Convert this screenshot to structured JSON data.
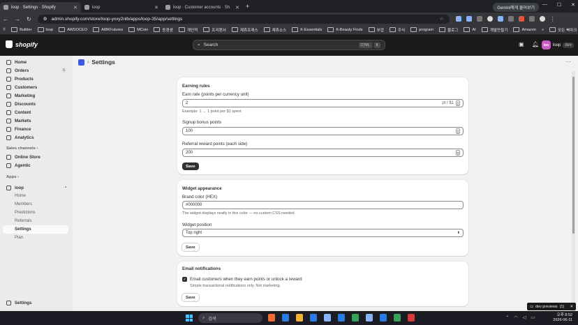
{
  "browser": {
    "tabs": [
      {
        "label": "loop · Settings · Shopify",
        "active": true
      },
      {
        "label": "loop",
        "active": false
      },
      {
        "label": "loop · Customer accounts · Sh",
        "active": false
      }
    ],
    "url": "admin.shopify.com/store/loop-yxxy2nlb/apps/loop-35/app/settings",
    "gemini": "Gemini에게 물어보기",
    "bookmarks": [
      "Builder",
      "loop",
      "AWSOCEO",
      "AI8KFutures",
      "MCoin",
      "동경생",
      "개인적",
      "프리랜서",
      "제휴프레스",
      "제휴소스",
      "K-Essentials",
      "K-Beauty Finds",
      "부업",
      "주식",
      "program",
      "블로그",
      "AI",
      "개발만들기",
      "Amazon",
      "모든 북마크"
    ]
  },
  "shopify": {
    "brand": "shopify",
    "search_placeholder": "Search",
    "shortcut": [
      "CTRL",
      "K"
    ],
    "store_initials": "loo",
    "store_name": "loop",
    "store_tag": "dev"
  },
  "sidebar": {
    "items": [
      {
        "label": "Home"
      },
      {
        "label": "Orders",
        "count": "5"
      },
      {
        "label": "Products"
      },
      {
        "label": "Customers"
      },
      {
        "label": "Marketing"
      },
      {
        "label": "Discounts"
      },
      {
        "label": "Content"
      },
      {
        "label": "Markets"
      },
      {
        "label": "Finance"
      },
      {
        "label": "Analytics"
      }
    ],
    "sales_channels": "Sales channels",
    "channels": [
      {
        "label": "Online Store"
      },
      {
        "label": "Agentic"
      }
    ],
    "apps": "Apps",
    "app_name": "loop",
    "app_sub": [
      "Home",
      "Members",
      "Predictions",
      "Referrals",
      "Settings",
      "Plan"
    ],
    "settings": "Settings"
  },
  "page": {
    "title": "Settings"
  },
  "earn": {
    "title": "Earning rules",
    "rate_label": "Earn rate (points per currency unit)",
    "rate_value": "2",
    "rate_suffix": "pt / $1",
    "rate_help": "Example: 1 → 1 point per $1 spent",
    "signup_label": "Signup bonus points",
    "signup_value": "100",
    "referral_label": "Referral reward points (each side)",
    "referral_value": "200",
    "save": "Save"
  },
  "widget": {
    "title": "Widget appearance",
    "color_label": "Brand color (HEX)",
    "color_value": "#000000",
    "color_help": "The widget displays neatly in this color — no custom CSS needed.",
    "position_label": "Widget position",
    "position_value": "Top right",
    "save": "Save"
  },
  "email": {
    "title": "Email notifications",
    "check_label": "Email customers when they earn points or unlock a reward",
    "check_help": "Simple transactional notifications only. Not marketing.",
    "save": "Save"
  },
  "toast": {
    "label": "dev previews",
    "count": "(1)"
  },
  "taskbar": {
    "search": "검색",
    "time": "오후 8:52",
    "date": "2026-06-11"
  }
}
